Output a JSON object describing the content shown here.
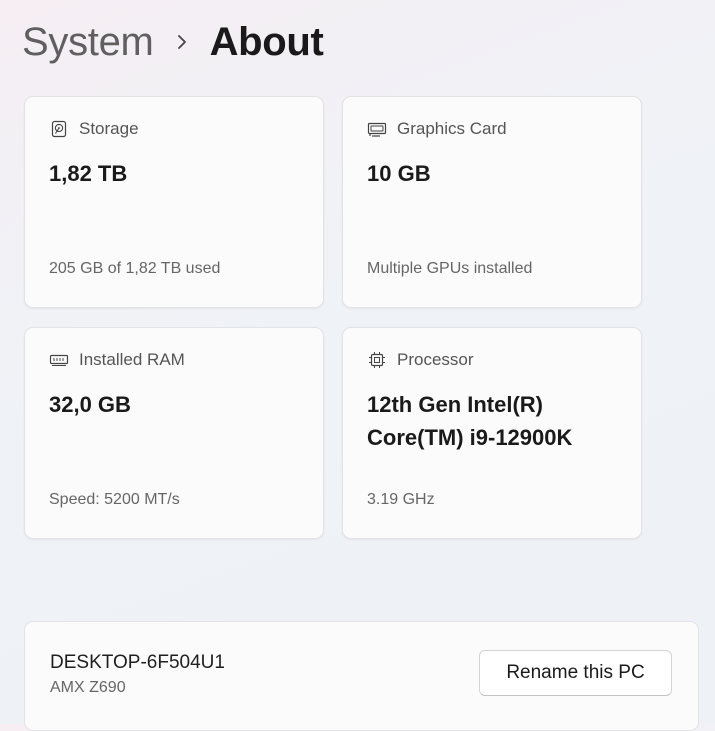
{
  "breadcrumb": {
    "parent": "System",
    "current": "About"
  },
  "cards": {
    "storage": {
      "icon": "hard-drive-icon",
      "title": "Storage",
      "value": "1,82 TB",
      "sub": "205 GB of 1,82 TB used"
    },
    "graphics": {
      "icon": "graphics-card-icon",
      "title": "Graphics Card",
      "value": "10 GB",
      "sub": "Multiple GPUs installed"
    },
    "ram": {
      "icon": "memory-icon",
      "title": "Installed RAM",
      "value": "32,0 GB",
      "sub": "Speed: 5200 MT/s"
    },
    "processor": {
      "icon": "processor-icon",
      "title": "Processor",
      "value": "12th Gen Intel(R) Core(TM) i9-12900K",
      "sub": "3.19 GHz"
    }
  },
  "device": {
    "name": "DESKTOP-6F504U1",
    "model": "AMX Z690",
    "rename_label": "Rename this PC"
  }
}
